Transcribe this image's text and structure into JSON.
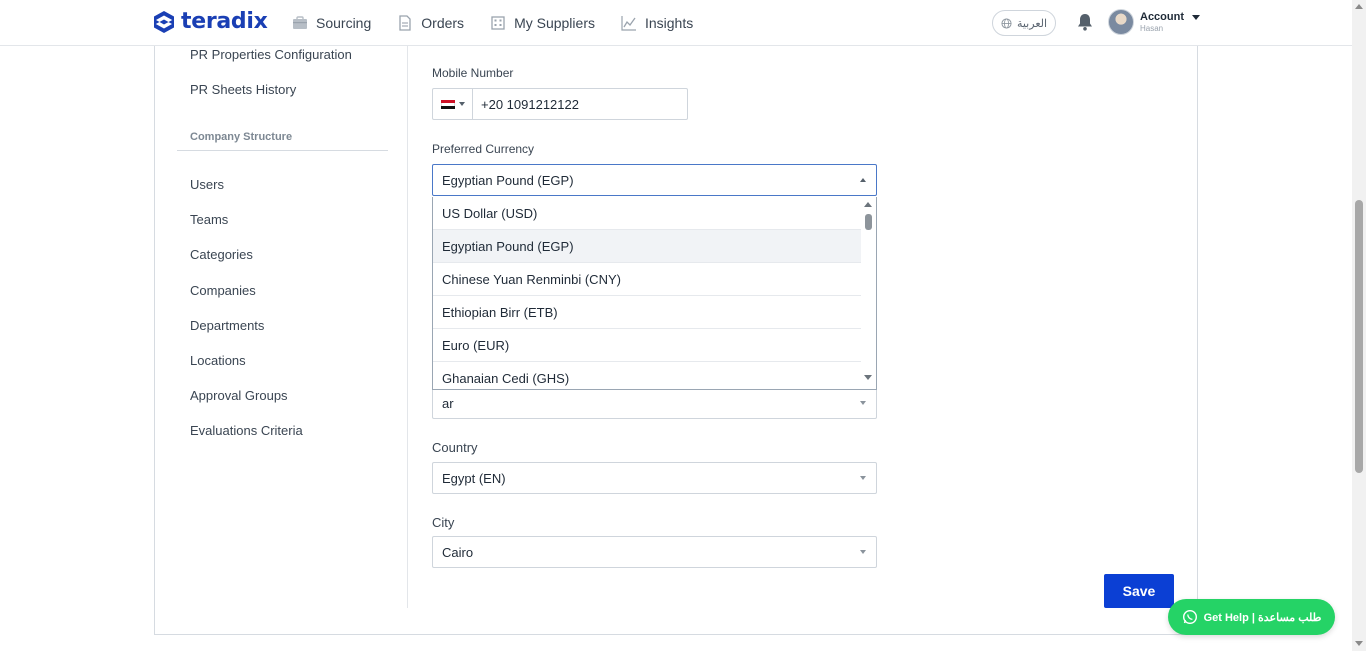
{
  "brand": {
    "name": "teradix",
    "color": "#1a3fb4"
  },
  "nav": [
    {
      "label": "Sourcing",
      "icon": "briefcase-icon"
    },
    {
      "label": "Orders",
      "icon": "document-icon"
    },
    {
      "label": "My Suppliers",
      "icon": "building-icon"
    },
    {
      "label": "Insights",
      "icon": "chart-line-icon"
    }
  ],
  "header": {
    "language_label": "العربية",
    "account_label": "Account",
    "account_sub": "Hasan"
  },
  "sidebar": {
    "top_items": [
      "PR Properties Configuration",
      "PR Sheets History"
    ],
    "section_title": "Company Structure",
    "items": [
      "Users",
      "Teams",
      "Categories",
      "Companies",
      "Departments",
      "Locations",
      "Approval Groups",
      "Evaluations Criteria"
    ]
  },
  "form": {
    "mobile_label": "Mobile Number",
    "mobile_value": "+20 1091212122",
    "currency_label": "Preferred Currency",
    "currency_value": "Egyptian Pound (EGP)",
    "currency_options": [
      "US Dollar (USD)",
      "Egyptian Pound (EGP)",
      "Chinese Yuan Renminbi (CNY)",
      "Ethiopian Birr (ETB)",
      "Euro (EUR)",
      "Ghanaian Cedi (GHS)"
    ],
    "currency_selected_index": 1,
    "language_value": "ar",
    "country_label": "Country",
    "country_value": "Egypt (EN)",
    "city_label": "City",
    "city_value": "Cairo",
    "save_label": "Save"
  },
  "help": {
    "label": "Get Help | طلب مساعدة",
    "color": "#25d366"
  },
  "colors": {
    "primary": "#0b3fd4",
    "border": "#cfd5dc"
  }
}
